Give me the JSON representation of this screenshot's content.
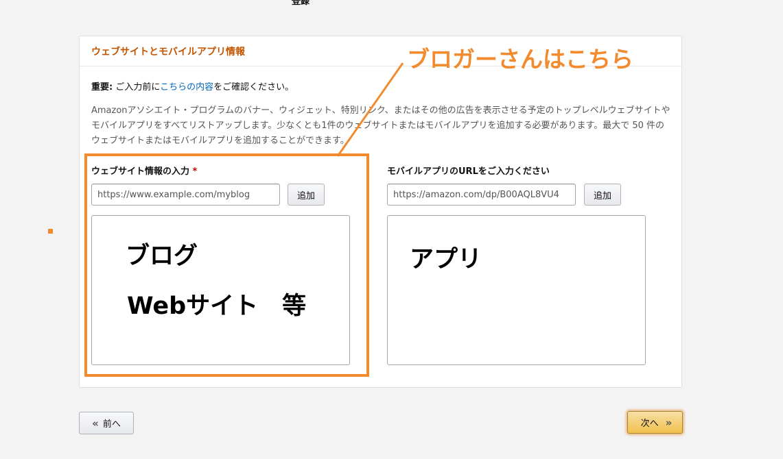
{
  "top_cut_label": "登録",
  "panel": {
    "title": "ウェブサイトとモバイルアプリ情報",
    "important_prefix": "重要:",
    "important_pre": " ご入力前に",
    "important_link": "こちらの内容",
    "important_post": "をご確認ください。",
    "description": "Amazonアソシエイト・プログラムのバナー、ウィジェット、特別リンク、またはその他の広告を表示させる予定のトップレベルウェブサイトやモバイルアプリをすべてリストアップします。少なくとも1件のウェブサイトまたはモバイルアプリを追加する必要があります。最大で 50 件のウェブサイトまたはモバイルアプリを追加することができます。"
  },
  "website": {
    "label": "ウェブサイト情報の入力",
    "required_mark": "*",
    "placeholder": "https://www.example.com/myblog",
    "add_label": "追加",
    "annotation_line1": "ブログ",
    "annotation_line2": "Webサイト　等"
  },
  "app": {
    "label": "モバイルアプリのURLをご入力ください",
    "placeholder": "https://amazon.com/dp/B00AQL8VU4",
    "add_label": "追加",
    "annotation": "アプリ"
  },
  "callout": "ブロガーさんはこちら",
  "nav": {
    "prev_label": "前へ",
    "next_label": "次へ"
  },
  "colors": {
    "accent_orange": "#f28a2e",
    "title_orange": "#c45500",
    "link_blue": "#0066c0",
    "primary_button": "#f0c14b"
  }
}
